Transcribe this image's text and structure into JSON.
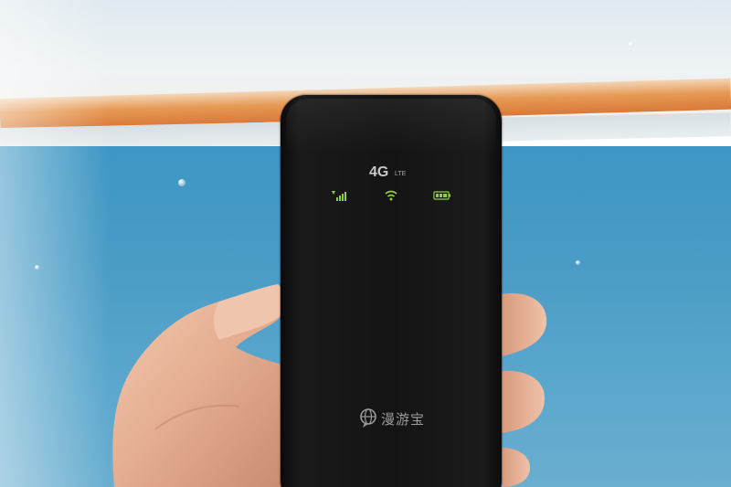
{
  "device": {
    "network_label": "4G",
    "network_sub": "LTE",
    "brand_text": "漫游宝",
    "indicator_color": "#8fd13a"
  },
  "indicators": [
    {
      "icon": "signal-bars-icon"
    },
    {
      "icon": "wifi-icon"
    },
    {
      "icon": "battery-icon"
    }
  ]
}
